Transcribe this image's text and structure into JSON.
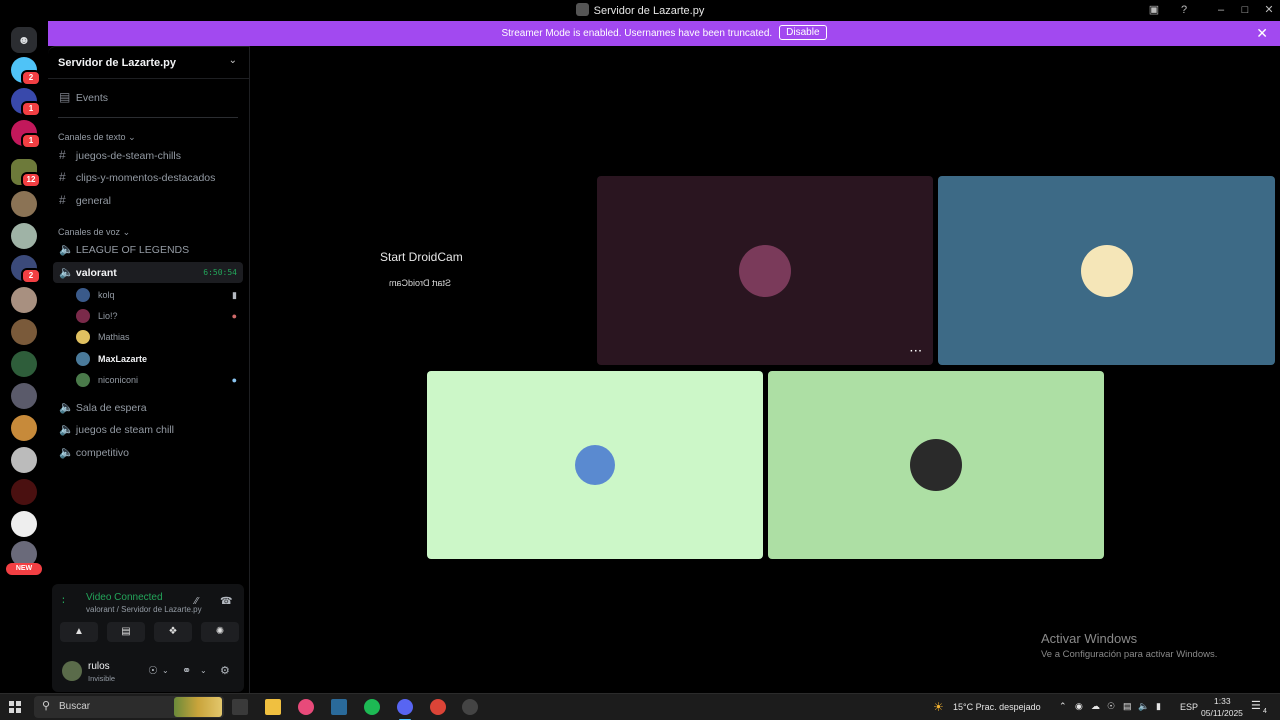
{
  "window": {
    "title": "Servidor de Lazarte.py"
  },
  "banner": {
    "message": "Streamer Mode is enabled. Usernames have been truncated.",
    "disable_label": "Disable"
  },
  "server": {
    "name": "Servidor de Lazarte.py",
    "events_label": "Events",
    "text_category": "Canales de texto",
    "text_channels": [
      "juegos-de-steam-chills",
      "clips-y-momentos-destacados",
      "general"
    ],
    "voice_category": "Canales de voz",
    "voice_channels": {
      "lol": "LEAGUE OF LEGENDS",
      "valorant": "valorant",
      "valorant_timer": "6:50:54",
      "sala": "Sala de espera",
      "juegos": "juegos de steam chill",
      "competitivo": "competitivo"
    },
    "voice_users": [
      "kolq",
      "Lio!?",
      "Mathias",
      "MaxLazarte",
      "niconiconi"
    ]
  },
  "voice_panel": {
    "status": "Video Connected",
    "location": "valorant / Servidor de Lazarte.py"
  },
  "user_panel": {
    "name": "rulos",
    "status": "Invisible"
  },
  "stage": {
    "droidcam_title": "Start DroidCam",
    "droidcam_mirror": "Start DroidCam",
    "more_label": "···"
  },
  "rail": {
    "badges": [
      "2",
      "1",
      "1",
      "12",
      "2"
    ],
    "new_label": "NEW"
  },
  "watermark": {
    "line1": "Activar Windows",
    "line2": "Ve a Configuración para activar Windows."
  },
  "taskbar": {
    "search_label": "Buscar",
    "weather": "15°C  Prac. despejado",
    "language": "ESP",
    "time": "1:33",
    "date": "05/11/2025",
    "notif_count": "4"
  },
  "colors": {
    "accent": "#a249f0",
    "online_green": "#23a55a",
    "tile_dark": "#2a1520",
    "tile_blue": "#3d6a86",
    "tile_lightgreen": "#ccf7c8",
    "tile_green": "#addfa4"
  }
}
